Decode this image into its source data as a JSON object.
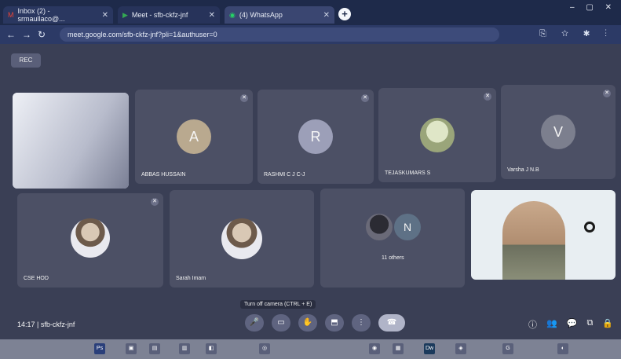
{
  "browser": {
    "tabs": [
      {
        "icon": "gmail-icon",
        "label": "Inbox (2) - srmaullaco@...",
        "close": "✕"
      },
      {
        "icon": "meet-icon",
        "label": "Meet - sfb-ckfz-jnf",
        "close": "✕"
      },
      {
        "icon": "whatsapp-icon",
        "label": "(4) WhatsApp",
        "close": "✕"
      }
    ],
    "new_tab": "+",
    "window_controls": "– ▢ ✕",
    "address": "meet.google.com/sfb-ckfz-jnf?pli=1&authuser=0",
    "nav": {
      "back": "←",
      "forward": "→",
      "reload": "↻"
    },
    "toolbar_icons": "⎘ ☆ ✱ ⋮"
  },
  "meeting": {
    "rec_label": "REC",
    "participants": [
      {
        "name": "",
        "type": "video-dark"
      },
      {
        "name": "ABBAS HUSSAIN",
        "initial": "A",
        "avatar_color": "#b9a98f"
      },
      {
        "name": "RASHMI C J C-J",
        "initial": "R",
        "avatar_color": "#9c9fb8"
      },
      {
        "name": "TEJASKUMARS S",
        "initial": "",
        "avatar_color": "#b8c39e"
      },
      {
        "name": "Varsha J N.B",
        "initial": "V",
        "avatar_color": "#7c7f8e"
      },
      {
        "name": "CSE HOD",
        "initial": "",
        "avatar_color": "#e8e8f0"
      },
      {
        "name": "Sarah Imam",
        "initial": "",
        "avatar_color": "#e8e8f0"
      },
      {
        "name": "11 others",
        "initial": "N",
        "avatar_color": "#5e7186"
      },
      {
        "name": "",
        "type": "self-video"
      }
    ],
    "time": "14:17",
    "meeting_code": "sfb-ckfz-jnf",
    "tooltip": "Turn off camera (CTRL + E)",
    "controls": [
      {
        "name": "mic-button",
        "glyph": "🎤"
      },
      {
        "name": "camera-button",
        "glyph": "▭"
      },
      {
        "name": "hand-button",
        "glyph": "✋"
      },
      {
        "name": "present-button",
        "glyph": "⬒"
      },
      {
        "name": "more-options-button",
        "glyph": "⋮"
      },
      {
        "name": "leave-call-button",
        "glyph": "☎"
      }
    ],
    "right_icons": [
      "ⓘ",
      "👥",
      "💬",
      "⧉",
      "🔒"
    ]
  },
  "taskbar": [
    "Ps",
    "▣",
    "▤",
    "▥",
    "◧",
    "◎",
    "◉",
    "Dw",
    "▦",
    "◈",
    "G",
    "◐"
  ]
}
